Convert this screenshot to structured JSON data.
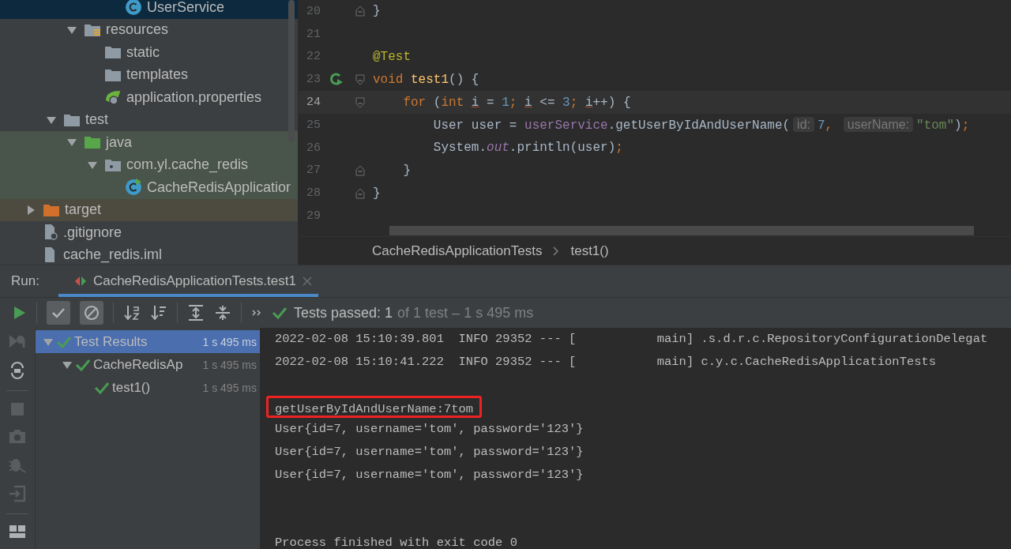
{
  "project_tree": [
    {
      "children": [
        {
          "children": [
            {
              "children": [
                {
                  "children": [
                    {
                      "label": "UserService",
                      "kind": "class",
                      "selected": true
                    }
                  ]
                }
              ]
            },
            {
              "label": "resources",
              "kind": "resources-folder",
              "expanded": true,
              "selected": false,
              "children": [
                {
                  "label": "static",
                  "kind": "folder",
                  "selected": false
                },
                {
                  "label": "templates",
                  "kind": "folder",
                  "selected": false
                },
                {
                  "label": "application.properties",
                  "kind": "spring-config",
                  "selected": false
                }
              ]
            }
          ]
        },
        {
          "label": "test",
          "kind": "folder",
          "expanded": true,
          "selected": false,
          "children": [
            {
              "label": "java",
              "kind": "test-source-folder",
              "expanded": true,
              "selected": false,
              "children": [
                {
                  "label": "com.yl.cache_redis",
                  "kind": "package",
                  "expanded": true,
                  "selected": false,
                  "children": [
                    {
                      "label": "CacheRedisApplicatior",
                      "kind": "test-class",
                      "selected": false
                    }
                  ]
                }
              ]
            }
          ]
        }
      ]
    },
    {
      "label": "target",
      "kind": "excluded-folder",
      "expanded": false,
      "selected": false
    },
    {
      "label": ".gitignore",
      "kind": "ignore-file",
      "selected": false
    },
    {
      "label": "cache_redis.iml",
      "kind": "module-file",
      "selected": false
    }
  ],
  "editor": {
    "lines": [
      {
        "number": "20",
        "current": false,
        "kind": "fold-end",
        "tokens": [
          {
            "kind": "plain",
            "text": "}"
          }
        ]
      },
      {
        "number": "21",
        "current": false,
        "kind": "plain"
      },
      {
        "number": "22",
        "current": false,
        "kind": "plain",
        "tokens": [
          {
            "kind": "annotation",
            "text": "@Test"
          }
        ]
      },
      {
        "number": "23",
        "current": false,
        "kind": "test-method",
        "tokens": [
          {
            "kind": "keyword",
            "text": "void "
          },
          {
            "kind": "declaration",
            "text": "test1"
          },
          {
            "kind": "plain",
            "text": "() {"
          }
        ]
      },
      {
        "number": "24",
        "current": true,
        "kind": "fold-start",
        "tokens": [
          {
            "kind": "keyword",
            "text": "    for"
          },
          {
            "kind": "plain",
            "text": " ("
          },
          {
            "kind": "keyword",
            "text": "int "
          },
          {
            "kind": "variable",
            "text": "i"
          },
          {
            "kind": "plain",
            "text": " = "
          },
          {
            "kind": "number",
            "text": "1"
          },
          {
            "kind": "keyword",
            "text": "; "
          },
          {
            "kind": "variable",
            "text": "i"
          },
          {
            "kind": "plain",
            "text": " <= "
          },
          {
            "kind": "number",
            "text": "3"
          },
          {
            "kind": "keyword",
            "text": "; "
          },
          {
            "kind": "variable",
            "text": "i"
          },
          {
            "kind": "plain",
            "text": "++) {"
          }
        ]
      },
      {
        "number": "25",
        "current": false,
        "kind": "plain",
        "tokens": [
          {
            "kind": "plain",
            "text": "        User user = "
          },
          {
            "kind": "field",
            "text": "userService"
          },
          {
            "kind": "plain",
            "text": ".getUserByIdAndUserName("
          },
          {
            "kind": "hint",
            "text": "id:"
          },
          {
            "kind": "number",
            "text": "7"
          },
          {
            "kind": "keyword",
            "text": ", "
          },
          {
            "kind": "hint",
            "text": "userName:"
          },
          {
            "kind": "string",
            "text": "\"tom\""
          },
          {
            "kind": "plain",
            "text": ")"
          },
          {
            "kind": "keyword",
            "text": ";"
          }
        ]
      },
      {
        "number": "26",
        "current": false,
        "kind": "plain",
        "tokens": [
          {
            "kind": "plain",
            "text": "        System."
          },
          {
            "kind": "static",
            "text": "out"
          },
          {
            "kind": "plain",
            "text": ".println(user)"
          },
          {
            "kind": "keyword",
            "text": ";"
          }
        ]
      },
      {
        "number": "27",
        "current": false,
        "kind": "fold-end",
        "tokens": [
          {
            "kind": "plain",
            "text": "    }"
          }
        ]
      },
      {
        "number": "28",
        "current": false,
        "kind": "fold-end",
        "tokens": [
          {
            "kind": "plain",
            "text": "}"
          }
        ]
      },
      {
        "number": "29",
        "current": false,
        "kind": "plain"
      }
    ],
    "breadcrumbs": [
      "CacheRedisApplicationTests",
      "test1()"
    ]
  },
  "run_panel": {
    "title": "Run:",
    "tabs": [
      {
        "label": "CacheRedisApplicationTests.test1",
        "selected": true
      }
    ],
    "filter_buttons": [
      {
        "kind": "passed",
        "selected": true
      },
      {
        "kind": "ignored",
        "selected": true
      }
    ],
    "status": {
      "main": "Tests passed: 1",
      "detail": "of 1 test – 1 s 495 ms"
    },
    "test_tree": [
      {
        "label": "Test Results",
        "time": "1 s 495 ms",
        "passed": true,
        "expanded": true,
        "selected": true,
        "children": [
          {
            "label": "CacheRedisAp",
            "time": "1 s 495 ms",
            "passed": true,
            "expanded": true,
            "selected": false,
            "children": [
              {
                "label": "test1()",
                "time": "1 s 495 ms",
                "passed": true,
                "selected": false
              }
            ]
          }
        ]
      }
    ],
    "console": [
      {
        "kind": "log",
        "text": "2022-02-08 15:10:39.801  INFO 29352 --- [           main] .s.d.r.c.RepositoryConfigurationDelegat"
      },
      {
        "kind": "log",
        "text": "2022-02-08 15:10:41.222  INFO 29352 --- [           main] c.y.c.CacheRedisApplicationTests"
      },
      {
        "kind": "boxed",
        "text": "getUserByIdAndUserName:7tom"
      },
      {
        "kind": "output",
        "text": "User{id=7, username='tom', password='123'}"
      },
      {
        "kind": "output",
        "text": "User{id=7, username='tom', password='123'}"
      },
      {
        "kind": "output",
        "text": "User{id=7, username='tom', password='123'}"
      },
      {
        "kind": "exit",
        "text": "Process finished with exit code 0"
      }
    ]
  }
}
